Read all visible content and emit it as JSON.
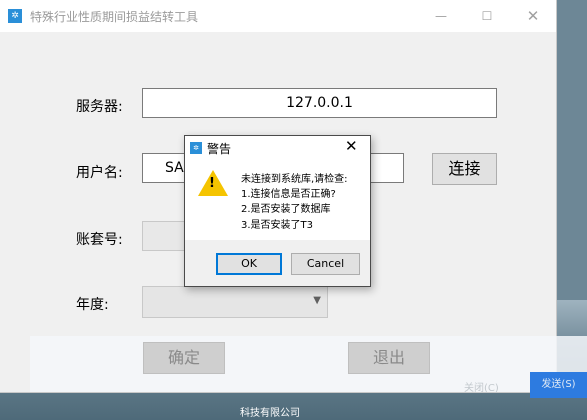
{
  "window": {
    "title": "特殊行业性质期间损益结转工具",
    "min_glyph": "—",
    "max_glyph": "☐",
    "close_glyph": "✕"
  },
  "form": {
    "server_label": "服务器:",
    "server_value": "127.0.0.1",
    "user_label": "用户名:",
    "user_value": "SA",
    "connect_button": "连接",
    "account_label": "账套号:",
    "year_label": "年度:",
    "confirm_button": "确定",
    "exit_button": "退出"
  },
  "dialog": {
    "title": "警告",
    "close_glyph": "✕",
    "lines": [
      "未连接到系统库,请检查:",
      "1.连接信息是否正确?",
      "2.是否安装了数据库",
      "3.是否安装了T3"
    ],
    "ok_button": "OK",
    "cancel_button": "Cancel"
  },
  "overlay": {
    "close_text": "关闭(C)",
    "send_text": "发送(S)"
  },
  "icons": {
    "app_icon": "app-icon",
    "warning_icon": "warning-icon",
    "dropdown": "chevron-down-icon"
  },
  "colors": {
    "accent": "#0078d7",
    "warning": "#f5c400",
    "send_button": "#2d7be0"
  }
}
